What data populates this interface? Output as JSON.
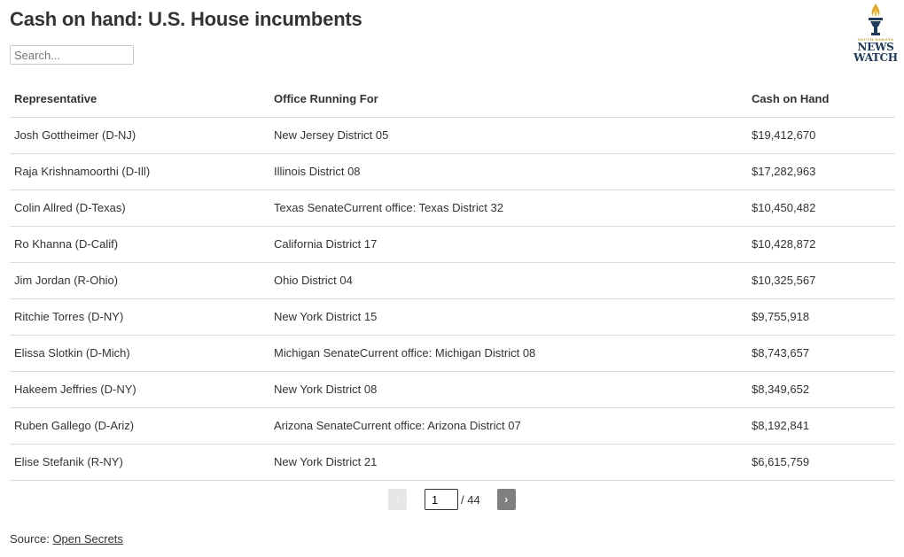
{
  "page": {
    "title": "Cash on hand: U.S. House incumbents"
  },
  "search": {
    "placeholder": "Search...",
    "value": ""
  },
  "logo": {
    "line1": "SOUTH DAKOTA",
    "line2": "NEWS",
    "line3": "WATCH",
    "accent_color": "#c9a23a",
    "brand_color": "#1f3a5a"
  },
  "table": {
    "headers": [
      "Representative",
      "Office Running For",
      "Cash on Hand"
    ],
    "rows": [
      [
        "Josh Gottheimer (D-NJ)",
        "New Jersey District 05",
        "$19,412,670"
      ],
      [
        "Raja Krishnamoorthi (D-Ill)",
        "Illinois District 08",
        "$17,282,963"
      ],
      [
        "Colin Allred (D-Texas)",
        "Texas SenateCurrent office: Texas District 32",
        "$10,450,482"
      ],
      [
        "Ro Khanna (D-Calif)",
        "California District 17",
        "$10,428,872"
      ],
      [
        "Jim Jordan (R-Ohio)",
        "Ohio District 04",
        "$10,325,567"
      ],
      [
        "Ritchie Torres (D-NY)",
        "New York District 15",
        "$9,755,918"
      ],
      [
        "Elissa Slotkin (D-Mich)",
        "Michigan SenateCurrent office: Michigan District 08",
        "$8,743,657"
      ],
      [
        "Hakeem Jeffries (D-NY)",
        "New York District 08",
        "$8,349,652"
      ],
      [
        "Ruben Gallego (D-Ariz)",
        "Arizona SenateCurrent office: Arizona District 07",
        "$8,192,841"
      ],
      [
        "Elise Stefanik (R-NY)",
        "New York District 21",
        "$6,615,759"
      ]
    ]
  },
  "pagination": {
    "prev_label": "‹",
    "next_label": "›",
    "current_page": "1",
    "total_label": "/ 44"
  },
  "footer": {
    "source_label": "Source:",
    "source_link": "Open Secrets"
  }
}
